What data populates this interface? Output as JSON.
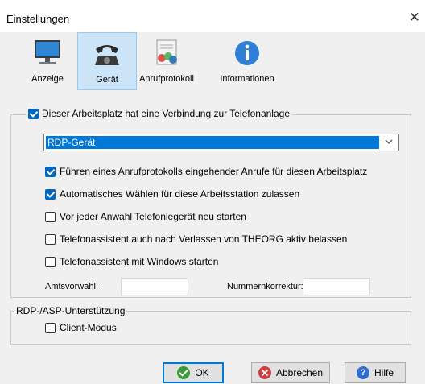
{
  "window": {
    "title": "Einstellungen",
    "close_glyph": "✕"
  },
  "tabs": [
    {
      "label": "Anzeige",
      "icon": "monitor-icon",
      "active": false
    },
    {
      "label": "Gerät",
      "icon": "telephone-icon",
      "active": true
    },
    {
      "label": "Anrufprotokoll",
      "icon": "call-log-icon",
      "active": false
    },
    {
      "label": "Informationen",
      "icon": "info-icon",
      "active": false
    }
  ],
  "phone_group": {
    "enabled_label": "Dieser Arbeitsplatz hat eine Verbindung zur Telefonanlage",
    "enabled": true,
    "device_select": {
      "value": "RDP-Gerät"
    },
    "options": [
      {
        "label": "Führen eines Anrufprotokolls eingehender Anrufe für diesen Arbeitsplatz",
        "checked": true
      },
      {
        "label": "Automatisches Wählen für diese Arbeitsstation zulassen",
        "checked": true
      },
      {
        "label": "Vor jeder Anwahl Telefoniegerät neu starten",
        "checked": false
      },
      {
        "label": "Telefonassistent auch nach Verlassen von THEORG aktiv belassen",
        "checked": false
      },
      {
        "label": "Telefonassistent mit Windows starten",
        "checked": false
      }
    ],
    "amtsvorwahl_label": "Amtsvorwahl:",
    "amtsvorwahl_value": "",
    "nummernkorrektur_label": "Nummernkorrektur:",
    "nummernkorrektur_value": ""
  },
  "rdp_group": {
    "title": "RDP-/ASP-Unterstützung",
    "client_mode_label": "Client-Modus",
    "client_mode": false
  },
  "buttons": {
    "ok": "OK",
    "cancel": "Abbrechen",
    "help": "Hilfe"
  },
  "colors": {
    "accent": "#0078d7",
    "active_tab_bg": "#cce4f7"
  }
}
